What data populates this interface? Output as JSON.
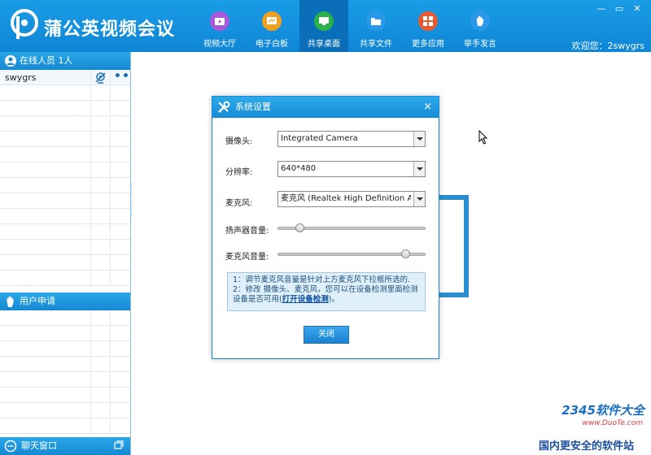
{
  "app": {
    "title": "蒲公英视频会议"
  },
  "nav": {
    "items": [
      {
        "label": "视频大厅",
        "icon": "video-hall-icon",
        "color": "#a65ad8",
        "active": false
      },
      {
        "label": "电子白板",
        "icon": "whiteboard-icon",
        "color": "#f0a020",
        "active": false
      },
      {
        "label": "共享桌面",
        "icon": "share-desktop-icon",
        "color": "#2ab24a",
        "active": true
      },
      {
        "label": "共享文件",
        "icon": "share-file-icon",
        "color": "#2a9ae8",
        "active": false
      },
      {
        "label": "更多应用",
        "icon": "more-apps-icon",
        "color": "#e85a30",
        "active": false
      },
      {
        "label": "举手发言",
        "icon": "raise-hand-icon",
        "color": "#2a9ae8",
        "active": false
      }
    ]
  },
  "window_controls": {
    "minimize": "—",
    "restore": "▭",
    "close": "✕"
  },
  "welcome": "欢迎您：2swygrs",
  "online_panel": {
    "title": "在线人员",
    "count": "1人",
    "users": [
      {
        "name": "swygrs"
      }
    ]
  },
  "apply_panel": {
    "title": "用户申请"
  },
  "chat_bar": {
    "label": "聊天窗口"
  },
  "dialog": {
    "title": "系统设置",
    "close_symbol": "×",
    "camera": {
      "label": "摄像头:",
      "value": "Integrated Camera"
    },
    "resolution": {
      "label": "分辨率:",
      "value": "640*480"
    },
    "microphone": {
      "label": "麦克风:",
      "value": "麦克风 (Realtek High Definition Audio)"
    },
    "speaker_volume": {
      "label": "扬声器音量:",
      "level": 0.15
    },
    "mic_volume": {
      "label": "麦克风音量:",
      "level": 0.86
    },
    "info": {
      "line1": "1：调节麦克风音量是针对上方麦克风下拉框所选的.",
      "line2": "2：修改 摄像头、麦克风，您可以在设备检测里面检测设备是否可用(",
      "link": "打开设备检测",
      "line2_end": ")。"
    },
    "close_button": "关闭"
  },
  "watermark": {
    "brand": "2345软件大全",
    "url": "www.DuoTe.com",
    "tagline": "国内更安全的软件站"
  }
}
